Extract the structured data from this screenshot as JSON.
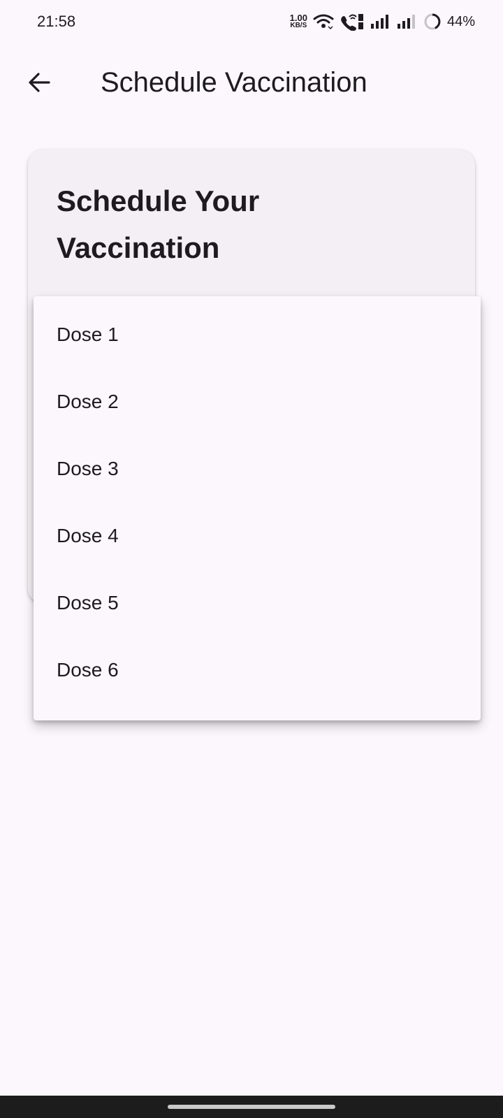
{
  "status_bar": {
    "time": "21:58",
    "net_speed_value": "1.00",
    "net_speed_unit": "KB/S",
    "battery_percent": "44%",
    "icons": [
      "wifi-icon",
      "wifi-calling-icon",
      "signal-icon-sim1",
      "signal-icon-sim2",
      "battery-icon"
    ]
  },
  "app_bar": {
    "back_icon": "arrow-back-icon",
    "title": "Schedule Vaccination"
  },
  "card": {
    "title": "Schedule Your Vaccination"
  },
  "dropdown": {
    "options": [
      "Dose 1",
      "Dose 2",
      "Dose 3",
      "Dose 4",
      "Dose 5",
      "Dose 6"
    ]
  },
  "colors": {
    "background": "#fcf7fc",
    "card": "#f3eff4",
    "text": "#1d1b20",
    "nav_bar": "#1c1c1c"
  }
}
